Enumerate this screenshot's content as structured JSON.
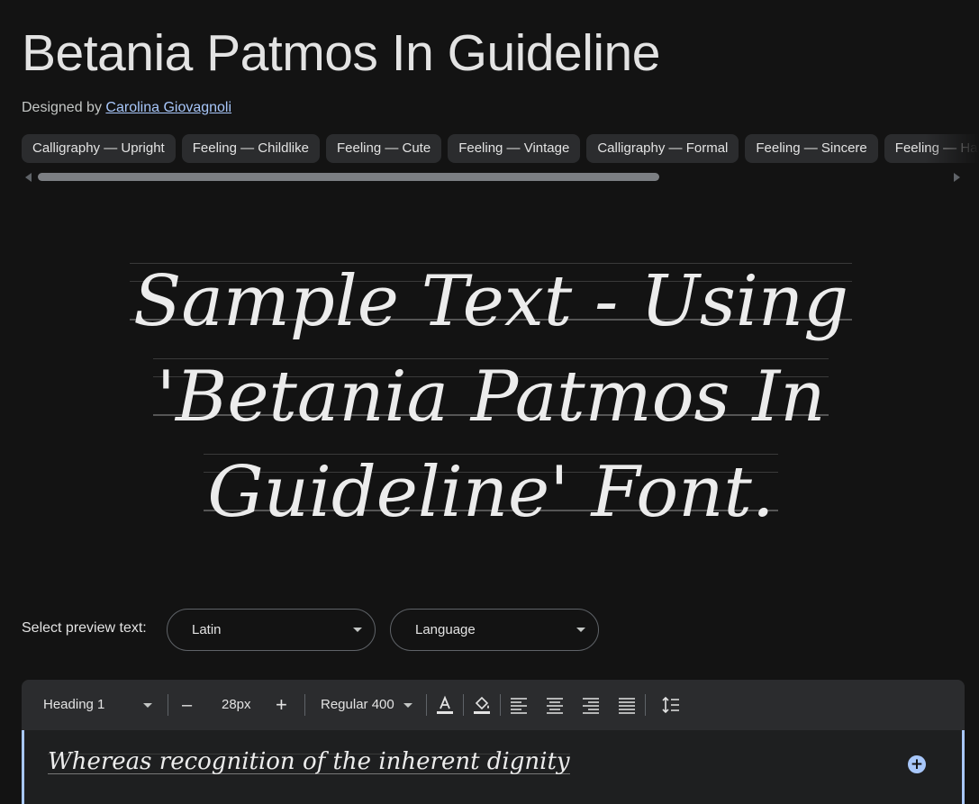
{
  "font": {
    "title": "Betania Patmos In Guideline",
    "designed_by_label": "Designed by",
    "designer_name": "Carolina Giovagnoli"
  },
  "tags": [
    "Calligraphy — Upright",
    "Feeling — Childlike",
    "Feeling — Cute",
    "Feeling — Vintage",
    "Calligraphy — Formal",
    "Feeling — Sincere",
    "Feeling — Happy"
  ],
  "preview": {
    "lines": [
      "Sample Text - Using",
      "'Betania Patmos In",
      "Guideline' Font."
    ]
  },
  "preview_controls": {
    "label": "Select preview text:",
    "script_select": "Latin",
    "language_select": "Language"
  },
  "toolbar": {
    "style_select": "Heading 1",
    "decrease_label": "–",
    "size": "28px",
    "increase_label": "+",
    "weight_select": "Regular 400",
    "icons": [
      "text-color-icon",
      "highlight-color-icon",
      "align-left-icon",
      "align-center-icon",
      "align-right-icon",
      "align-justify-icon",
      "line-height-icon"
    ]
  },
  "editor": {
    "text": "Whereas recognition of the inherent dignity",
    "add_label": "+"
  },
  "colors": {
    "background": "#131313",
    "chip": "#2b2c2e",
    "accent": "#a8c7fa",
    "text": "#e3e3e3"
  }
}
